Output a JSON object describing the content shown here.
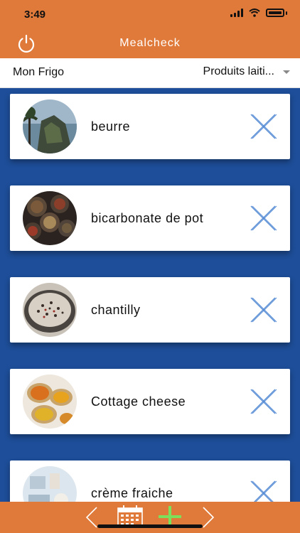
{
  "status": {
    "time": "3:49"
  },
  "header": {
    "title": "Mealcheck"
  },
  "subheader": {
    "fridge_label": "Mon Frigo",
    "category_selected": "Produits laiti..."
  },
  "items": [
    {
      "name": "beurre",
      "thumb": "landscape"
    },
    {
      "name": "bicarbonate de pot",
      "thumb": "spices-bowls"
    },
    {
      "name": "chantilly",
      "thumb": "rice-bowl"
    },
    {
      "name": "Cottage cheese",
      "thumb": "spoons-spices"
    },
    {
      "name": "crème fraiche",
      "thumb": "kitchen-items"
    }
  ],
  "icons": {
    "power": "power-icon",
    "delete": "close-icon",
    "prev": "chevron-left-icon",
    "calendar": "calendar-icon",
    "add": "plus-icon",
    "next": "chevron-right-icon"
  },
  "colors": {
    "header": "#E07A3A",
    "background": "#1E4E99",
    "card": "#FFFFFF",
    "delete_icon": "#5B8FD6",
    "add_icon": "#7CE05A"
  }
}
